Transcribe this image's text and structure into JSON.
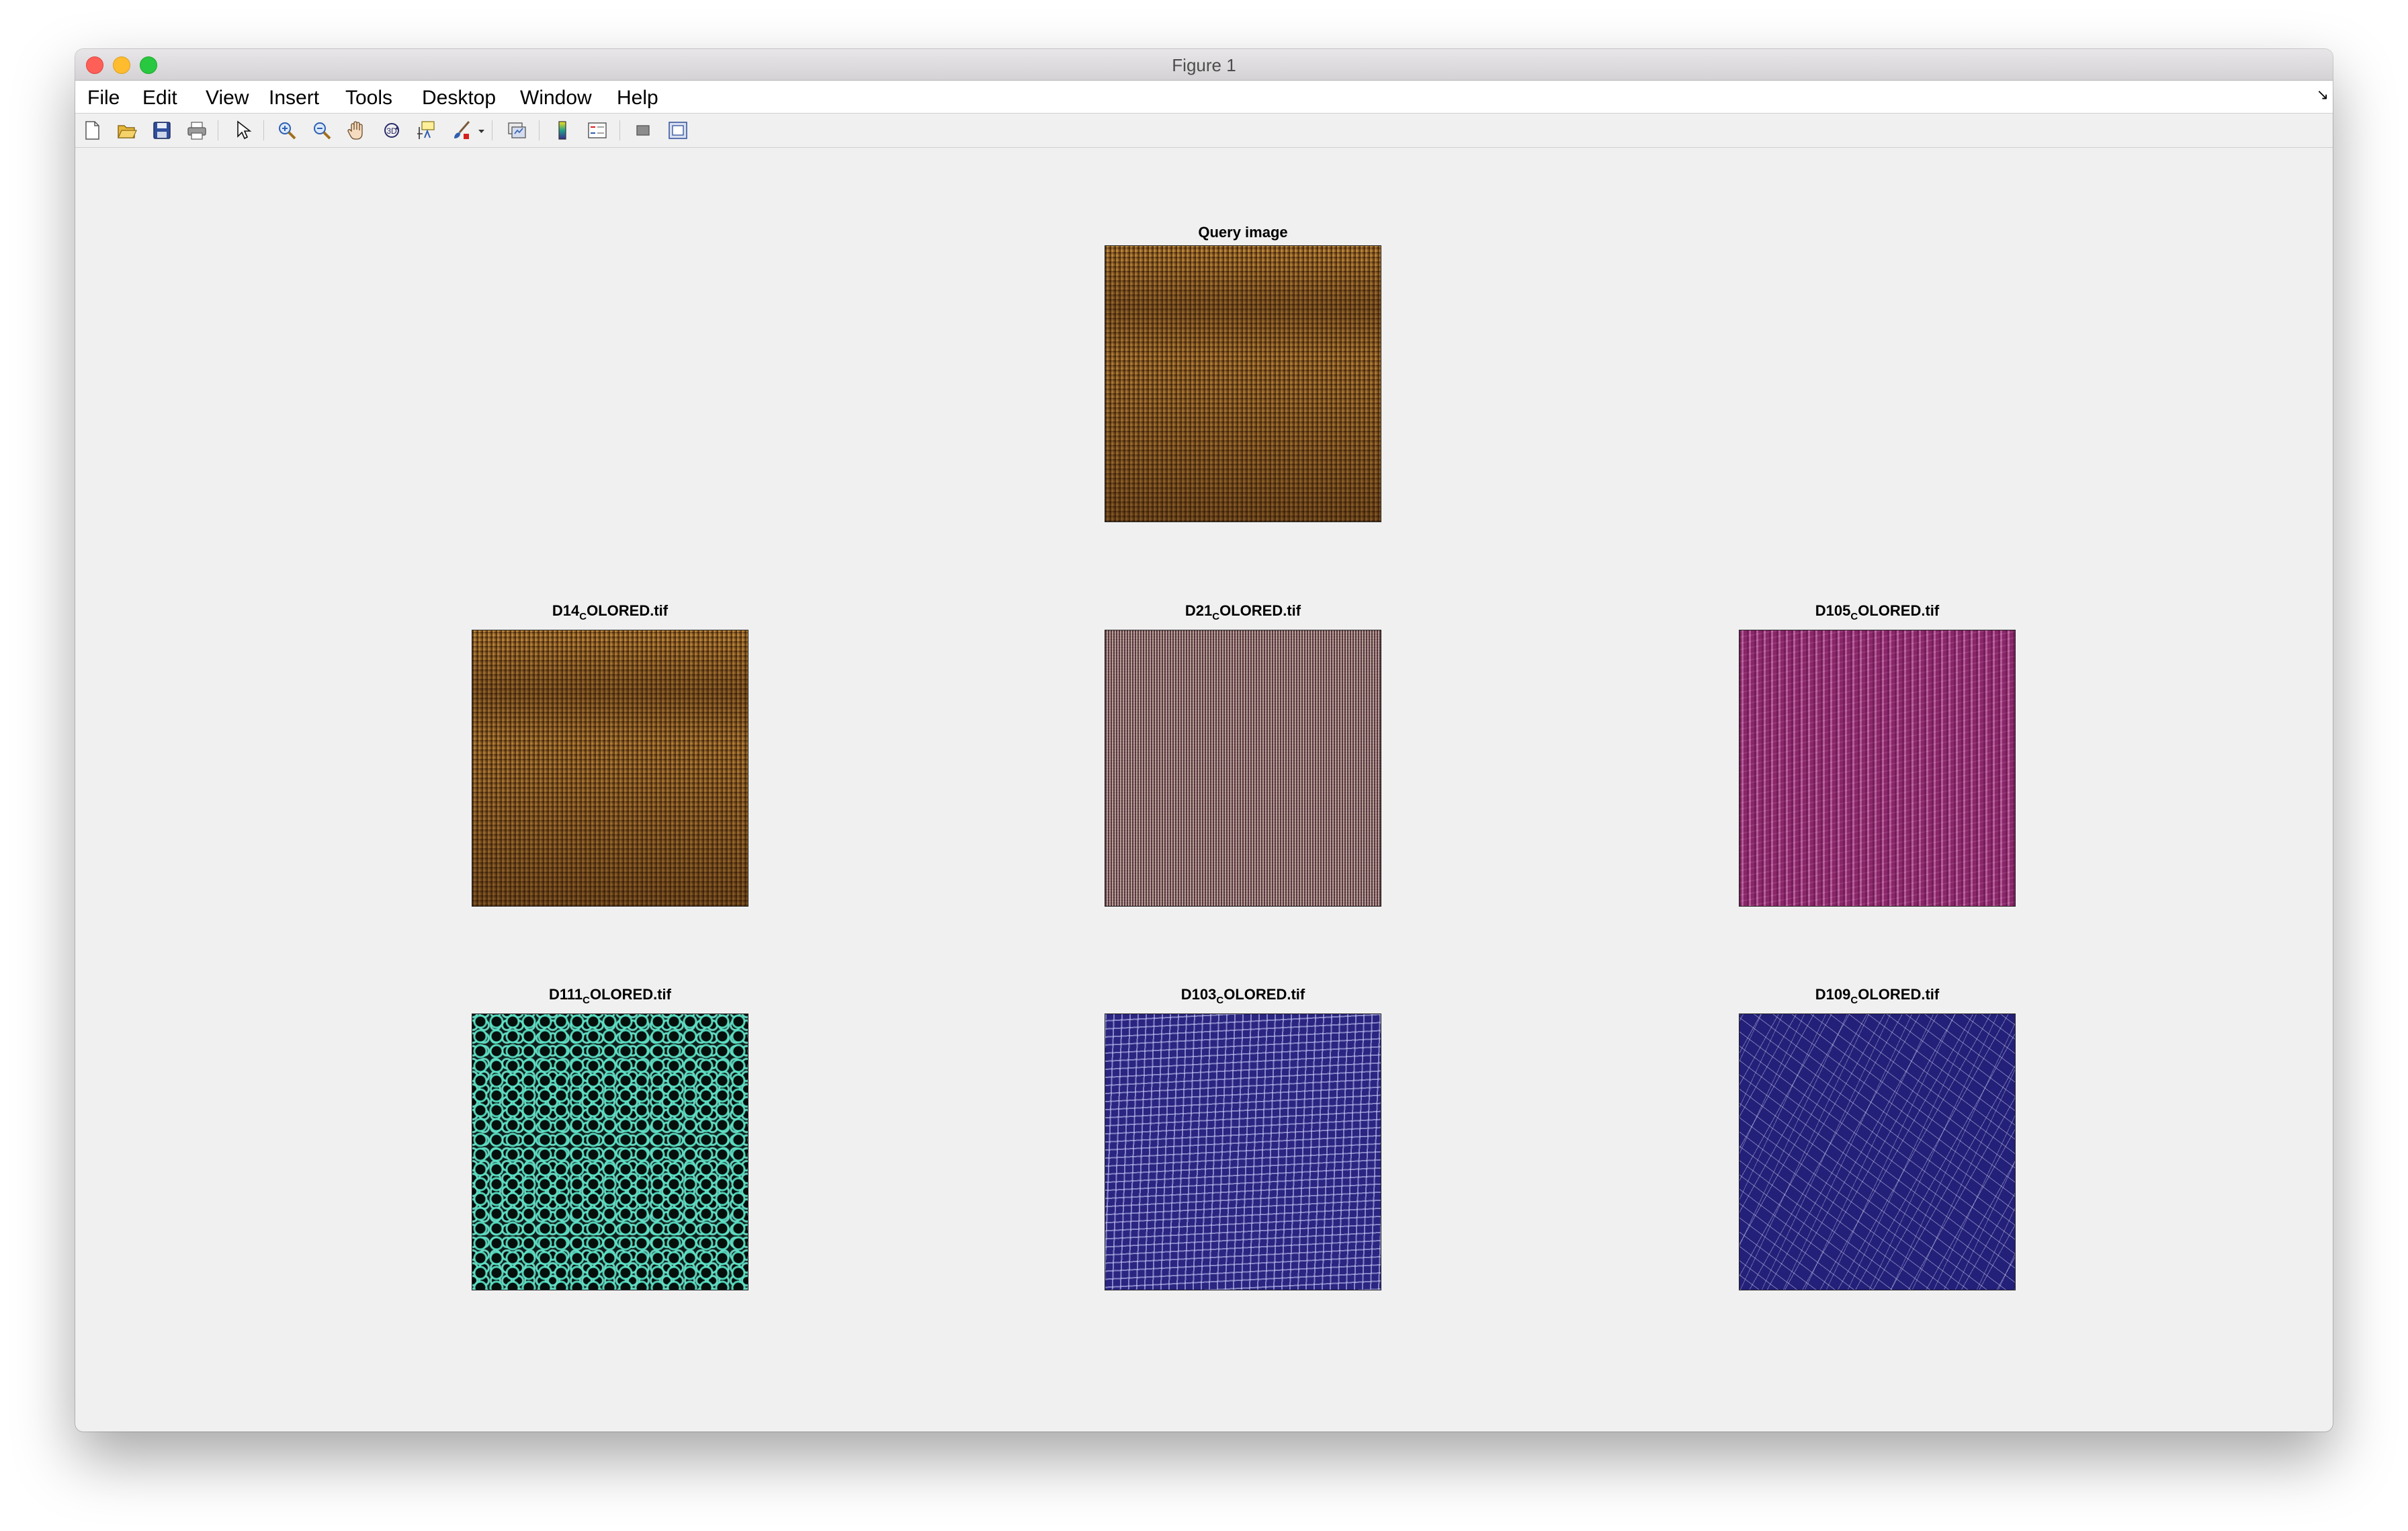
{
  "window": {
    "title": "Figure 1"
  },
  "menu": [
    "File",
    "Edit",
    "View",
    "Insert",
    "Tools",
    "Desktop",
    "Window",
    "Help"
  ],
  "toolbar_icons": [
    "new-figure-icon",
    "open-file-icon",
    "save-icon",
    "print-icon",
    "edit-plot-arrow-icon",
    "zoom-in-icon",
    "zoom-out-icon",
    "pan-hand-icon",
    "rotate-3d-icon",
    "data-cursor-icon",
    "brush-icon",
    "link-plot-icon",
    "insert-colorbar-icon",
    "insert-legend-icon",
    "hide-plot-tools-icon",
    "show-plot-tools-icon"
  ],
  "axes": {
    "query": {
      "title": "Query image"
    },
    "r1": {
      "title_main": "D14",
      "title_sub": "C",
      "title_rest": "OLORED.tif"
    },
    "r2": {
      "title_main": "D21",
      "title_sub": "C",
      "title_rest": "OLORED.tif"
    },
    "r3": {
      "title_main": "D105",
      "title_sub": "C",
      "title_rest": "OLORED.tif"
    },
    "r4": {
      "title_main": "D111",
      "title_sub": "C",
      "title_rest": "OLORED.tif"
    },
    "r5": {
      "title_main": "D103",
      "title_sub": "C",
      "title_rest": "OLORED.tif"
    },
    "r6": {
      "title_main": "D109",
      "title_sub": "C",
      "title_rest": "OLORED.tif"
    }
  },
  "colors": {
    "query_texture": "#a8742e",
    "d21_texture": "#8c7474",
    "d105_texture": "#a03c86",
    "d111_texture": "#5ae6c8",
    "d103_texture": "#2a2580",
    "d109_texture": "#232079"
  }
}
